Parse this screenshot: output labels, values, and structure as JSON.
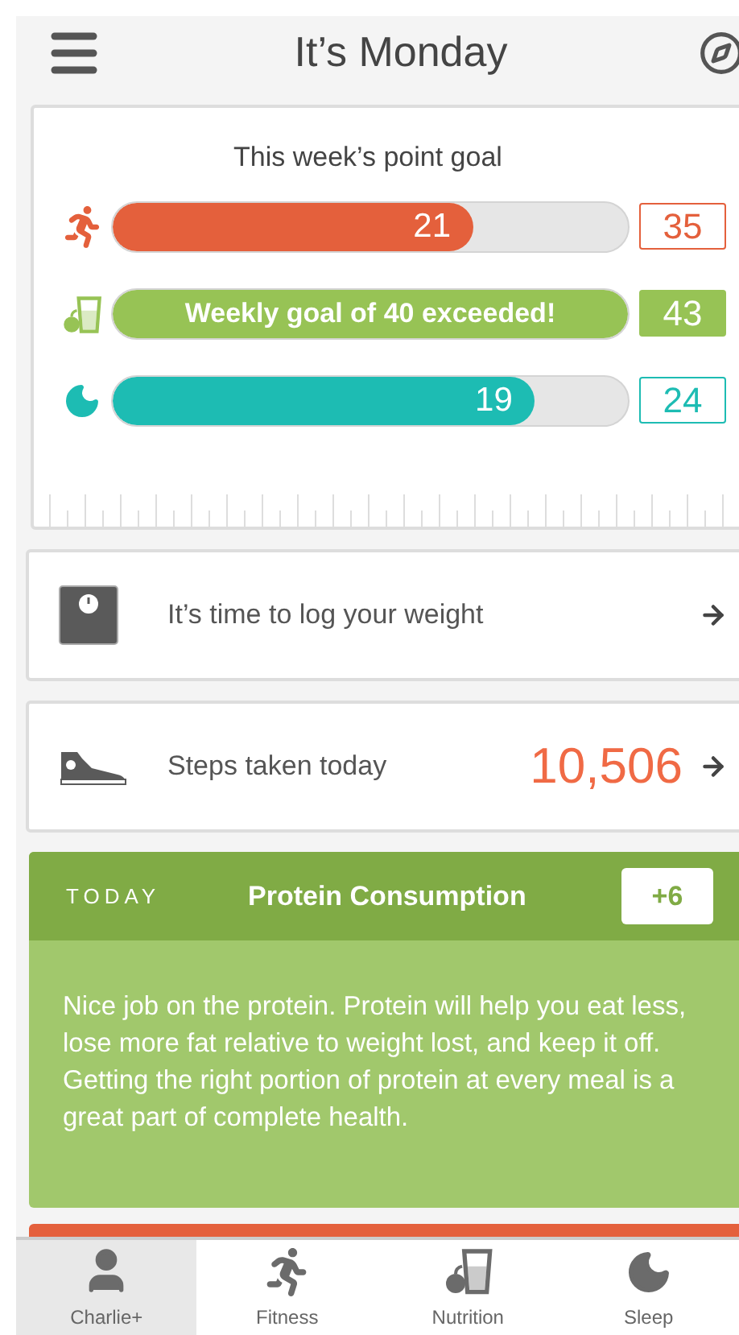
{
  "header": {
    "title": "It’s Monday"
  },
  "points": {
    "title": "This week’s point goal",
    "goals": [
      {
        "kind": "fitness",
        "color": "#e4603c",
        "level": 0.7,
        "bar_text": "21",
        "goal": "35",
        "exceeded": false
      },
      {
        "kind": "nutrition",
        "color": "#97c355",
        "level": 1,
        "bar_text": "Weekly goal of 40 exceeded!",
        "goal": "43",
        "exceeded": true
      },
      {
        "kind": "sleep",
        "color": "#1dbcb3",
        "level": 0.82,
        "bar_text": "19",
        "goal": "24",
        "exceeded": false
      }
    ]
  },
  "weight_card": {
    "text": "It’s time to log your weight"
  },
  "steps_card": {
    "text": "Steps taken today",
    "value": "10,506"
  },
  "tip_card": {
    "label": "TODAY",
    "title": "Protein Consumption",
    "points": "+6",
    "body": "Nice job on the protein. Protein will help you eat less, lose more fat relative to weight lost, and keep it off. Getting the right portion of protein at every meal is a great part of complete health."
  },
  "tabs": [
    {
      "kind": "profile",
      "label": "Charlie+",
      "selected": true
    },
    {
      "kind": "fitness",
      "label": "Fitness",
      "selected": false
    },
    {
      "kind": "nutrition",
      "label": "Nutrition",
      "selected": false
    },
    {
      "kind": "sleep",
      "label": "Sleep",
      "selected": false
    }
  ]
}
